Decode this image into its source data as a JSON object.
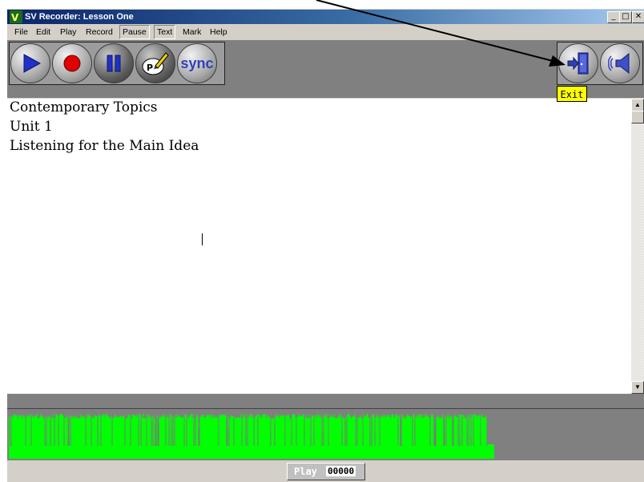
{
  "window": {
    "title": "SV Recorder: Lesson One",
    "caption_buttons": {
      "minimize": "_",
      "maximize": "□",
      "close": "✕"
    }
  },
  "menubar": {
    "items": [
      "File",
      "Edit",
      "Play",
      "Record",
      "Pause",
      "Text",
      "Mark",
      "Help"
    ]
  },
  "toolbar": {
    "buttons": [
      "play-icon",
      "record-icon",
      "pause-icon",
      "text-icon",
      "sync-icon",
      "exit-icon",
      "speaker-icon"
    ],
    "sync_label": "sync",
    "tooltip": "Exit"
  },
  "editor": {
    "lines": [
      "Contemporary Topics",
      "Unit 1",
      "Listening for the Main Idea"
    ]
  },
  "status": {
    "play_label": "Play",
    "counter": "00000"
  },
  "colors": {
    "waveform": "#00ff00",
    "toolbar_bg": "#808080",
    "tooltip_bg": "#ffff00",
    "play_icon": "#2030c8",
    "record_icon": "#e00000"
  }
}
